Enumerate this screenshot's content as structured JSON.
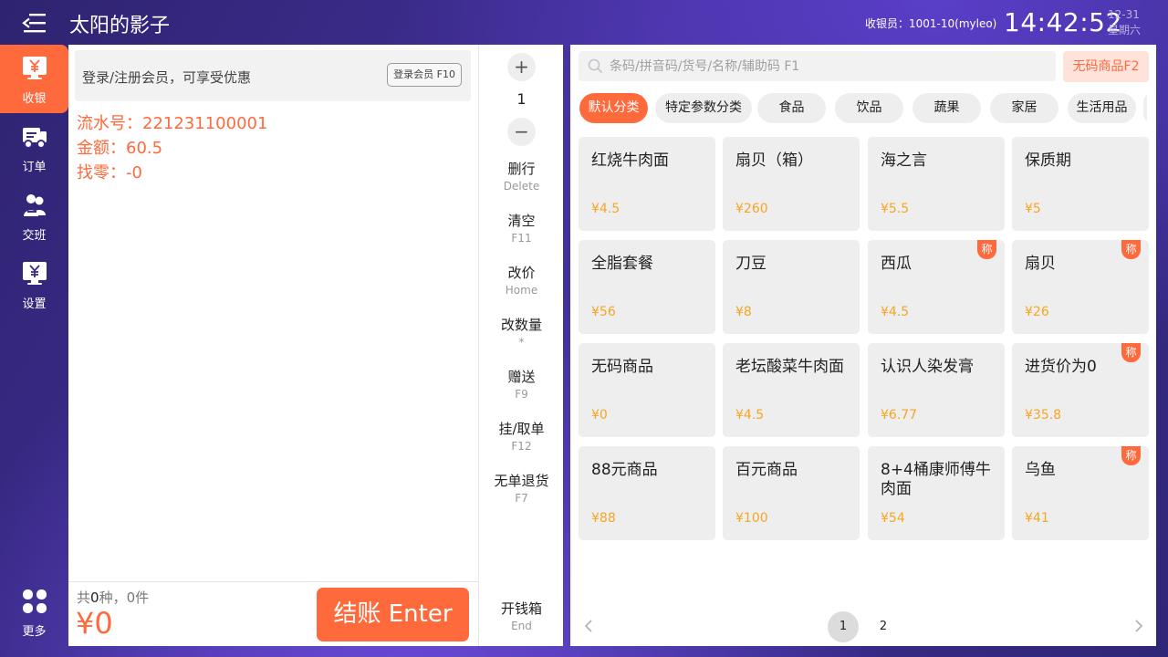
{
  "colors": {
    "accent": "#ff6a3d",
    "price": "#f5a623",
    "background": "#3a2a86",
    "panel": "#ffffff"
  },
  "header": {
    "menu_icon": "menu-collapse-icon",
    "store_name": "太阳的影子",
    "cashier": "收银员：1001-10(myleo)",
    "time": "14:42:52",
    "date": "12-31",
    "weekday": "星期六"
  },
  "nav": {
    "items": [
      {
        "label": "收银",
        "icon": "yen-monitor-icon"
      },
      {
        "label": "订单",
        "icon": "order-icon"
      },
      {
        "label": "交班",
        "icon": "shift-handover-icon"
      },
      {
        "label": "设置",
        "icon": "settings-monitor-icon"
      }
    ],
    "more": {
      "label": "更多",
      "icon": "more-grid-icon"
    }
  },
  "cart": {
    "member_prompt": "登录/注册会员，可享受优惠",
    "member_button": "登录会员 F10",
    "serial": "流水号：221231100001",
    "amount": "金额：60.5",
    "change": "找零：-0",
    "summary_prefix": "共",
    "summary_kinds": "0",
    "summary_middle": "种，",
    "summary_items": "0件",
    "total": "¥0",
    "checkout": "结账 Enter"
  },
  "tools": {
    "plus": "+",
    "quantity": "1",
    "minus": "−",
    "delete": {
      "label": "删行",
      "key": "Delete"
    },
    "clear": {
      "label": "清空",
      "key": "F11"
    },
    "change_price": {
      "label": "改价",
      "key": "Home"
    },
    "change_qty": {
      "label": "改数量",
      "key": "*"
    },
    "gift": {
      "label": "赠送",
      "key": "F9"
    },
    "hold": {
      "label": "挂/取单",
      "key": "F12"
    },
    "refund": {
      "label": "无单退货",
      "key": "F7"
    },
    "cashbox": {
      "label": "开钱箱",
      "key": "End"
    }
  },
  "search": {
    "placeholder": "条码/拼音码/货号/名称/辅助码 F1",
    "nocode_button": "无码商品F2"
  },
  "categories": [
    "默认分类",
    "特定参数分类",
    "食品",
    "饮品",
    "蔬果",
    "家居",
    "生活用品"
  ],
  "products": [
    {
      "name": "红烧牛肉面",
      "price": "¥4.5",
      "tag": ""
    },
    {
      "name": "扇贝（箱）",
      "price": "¥260",
      "tag": ""
    },
    {
      "name": "海之言",
      "price": "¥5.5",
      "tag": ""
    },
    {
      "name": "保质期",
      "price": "¥5",
      "tag": ""
    },
    {
      "name": "全脂套餐",
      "price": "¥56",
      "tag": ""
    },
    {
      "name": "刀豆",
      "price": "¥8",
      "tag": ""
    },
    {
      "name": "西瓜",
      "price": "¥4.5",
      "tag": "称"
    },
    {
      "name": "扇贝",
      "price": "¥26",
      "tag": "称"
    },
    {
      "name": "无码商品",
      "price": "¥0",
      "tag": ""
    },
    {
      "name": "老坛酸菜牛肉面",
      "price": "¥4.5",
      "tag": ""
    },
    {
      "name": "认识人染发膏",
      "price": "¥6.77",
      "tag": ""
    },
    {
      "name": "进货价为0",
      "price": "¥35.8",
      "tag": "称"
    },
    {
      "name": "88元商品",
      "price": "¥88",
      "tag": ""
    },
    {
      "name": "百元商品",
      "price": "¥100",
      "tag": ""
    },
    {
      "name": "8+4桶康师傅牛肉面",
      "price": "¥54",
      "tag": ""
    },
    {
      "name": "乌鱼",
      "price": "¥41",
      "tag": "称"
    }
  ],
  "pager": {
    "pages": [
      "1",
      "2"
    ],
    "current": "1"
  }
}
